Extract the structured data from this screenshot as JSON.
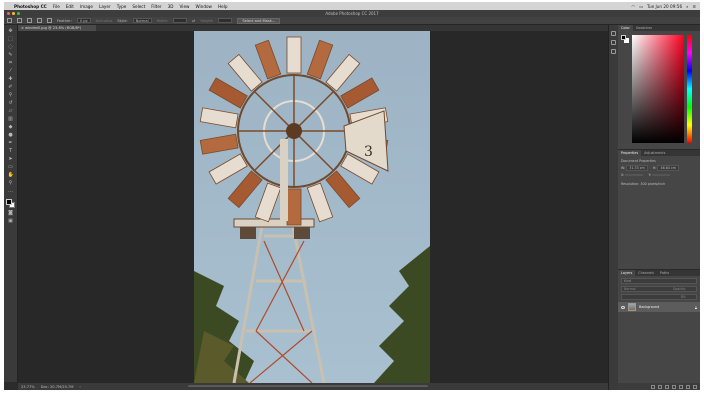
{
  "menubar": {
    "app_name": "Photoshop CC",
    "items": [
      "File",
      "Edit",
      "Image",
      "Layer",
      "Type",
      "Select",
      "Filter",
      "3D",
      "View",
      "Window",
      "Help"
    ],
    "clock": "Tue Jun 20 09:56"
  },
  "window": {
    "title": "Adobe Photoshop CC 2017"
  },
  "options": {
    "feather_label": "Feather:",
    "feather_value": "0 px",
    "antialias_label": "Anti-alias",
    "style_label": "Style:",
    "style_value": "Normal",
    "width_label": "Width:",
    "height_label": "Height:",
    "select_mask_button": "Select and Mask..."
  },
  "document": {
    "tab_label": "windmill.jpg @ 23.8% (RGB/8*)",
    "zoom": "23.77%",
    "doc_size": "Doc: 20.7M/20.7M"
  },
  "color_panel": {
    "tabs": [
      "Color",
      "Swatches"
    ],
    "accent": "#ff0022"
  },
  "properties_panel": {
    "tabs": [
      "Properties",
      "Adjustments"
    ],
    "title": "Document Properties",
    "w_label": "W:",
    "w_value": "31.33 cm",
    "h_label": "H:",
    "h_value": "46.64 cm",
    "x_label": "X:",
    "y_label": "Y:",
    "resolution": "Resolution: 300 pixels/inch"
  },
  "layers_panel": {
    "tabs": [
      "Layers",
      "Channels",
      "Paths"
    ],
    "kind_label": "Kind",
    "blend_mode": "Normal",
    "opacity_label": "Opacity:",
    "fill_label": "Fill:",
    "layer_name": "Background"
  }
}
